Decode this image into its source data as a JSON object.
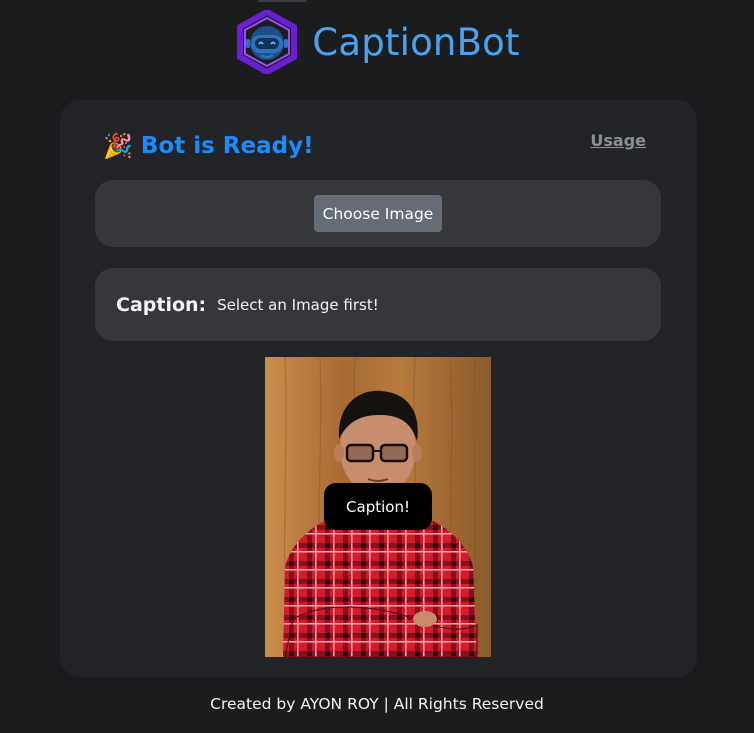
{
  "header": {
    "brand": "CaptionBot",
    "logo_icon": "robot-hexagon-icon"
  },
  "status": {
    "emoji": "🎉",
    "text": "Bot is Ready!"
  },
  "nav": {
    "usage_label": "Usage"
  },
  "upload": {
    "button_label": "Choose Image"
  },
  "caption": {
    "label": "Caption:",
    "value": "Select an Image first!",
    "button_label": "Caption!"
  },
  "footer": {
    "text": "Created by AYON ROY | All Rights Reserved"
  },
  "colors": {
    "background": "#1b1c1e",
    "card": "#232427",
    "panel": "#36373b",
    "brand_blue": "#4aa3ee",
    "status_blue": "#1a8cff",
    "logo_purple": "#7b2fe0",
    "button_gray": "#666c75"
  }
}
